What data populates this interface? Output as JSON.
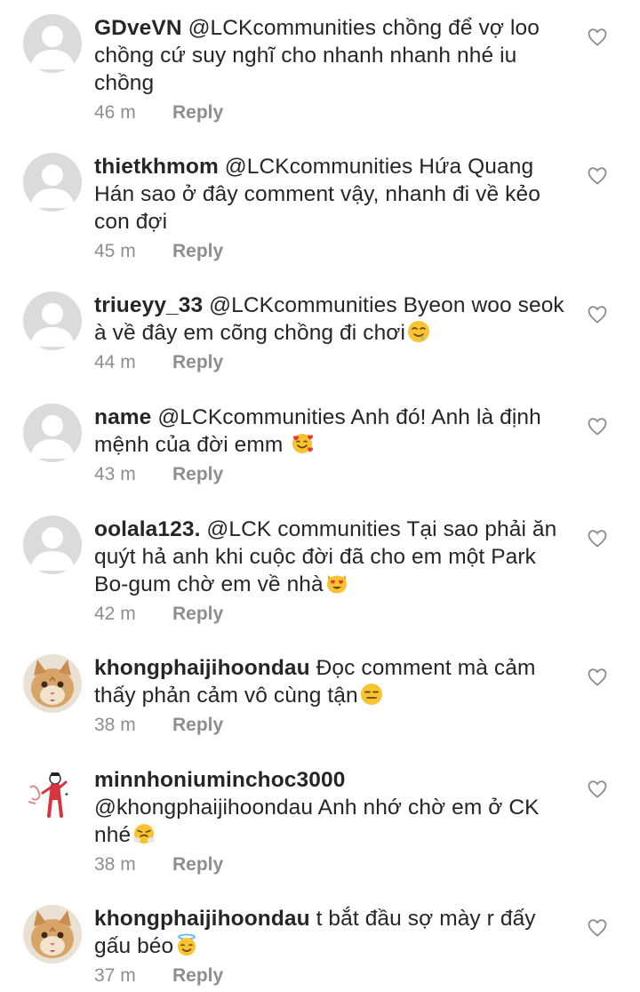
{
  "reply_label": "Reply",
  "comments": [
    {
      "username": "GDveVN",
      "text": "@LCKcommunities chồng để vợ loo chồng cứ suy nghĩ cho nhanh nhanh nhé iu chồng",
      "time": "46 m"
    },
    {
      "username": "thietkhmom",
      "text": "@LCKcommunities Hứa Quang Hán sao ở đây comment vậy, nhanh đi về kẻo con đợi",
      "time": "45 m"
    },
    {
      "username": "triueyy_33",
      "text": "@LCKcommunities Byeon woo seok à về đây em cõng chồng đi chơi",
      "time": "44 m"
    },
    {
      "username": "name",
      "text": "@LCKcommunities Anh đó! Anh là định mệnh của đời emm",
      "time": "43 m"
    },
    {
      "username": "oolala123.",
      "text": "@LCK communities Tại sao phải ăn quýt hả anh khi cuộc đời đã cho em một Park Bo-gum chờ em về nhà",
      "time": "42 m"
    },
    {
      "username": "khongphaijihoondau",
      "text": "Đọc comment mà cảm thấy phản cảm vô cùng tận",
      "time": "38 m"
    },
    {
      "username": "minnhoniuminchoc3000",
      "text": "@khongphaijihoondau Anh nhớ chờ em ở CK nhé",
      "time": "38 m"
    },
    {
      "username": "khongphaijihoondau",
      "text": "t bắt đầu sợ mày r đấy gấu béo",
      "time": "37 m"
    }
  ]
}
